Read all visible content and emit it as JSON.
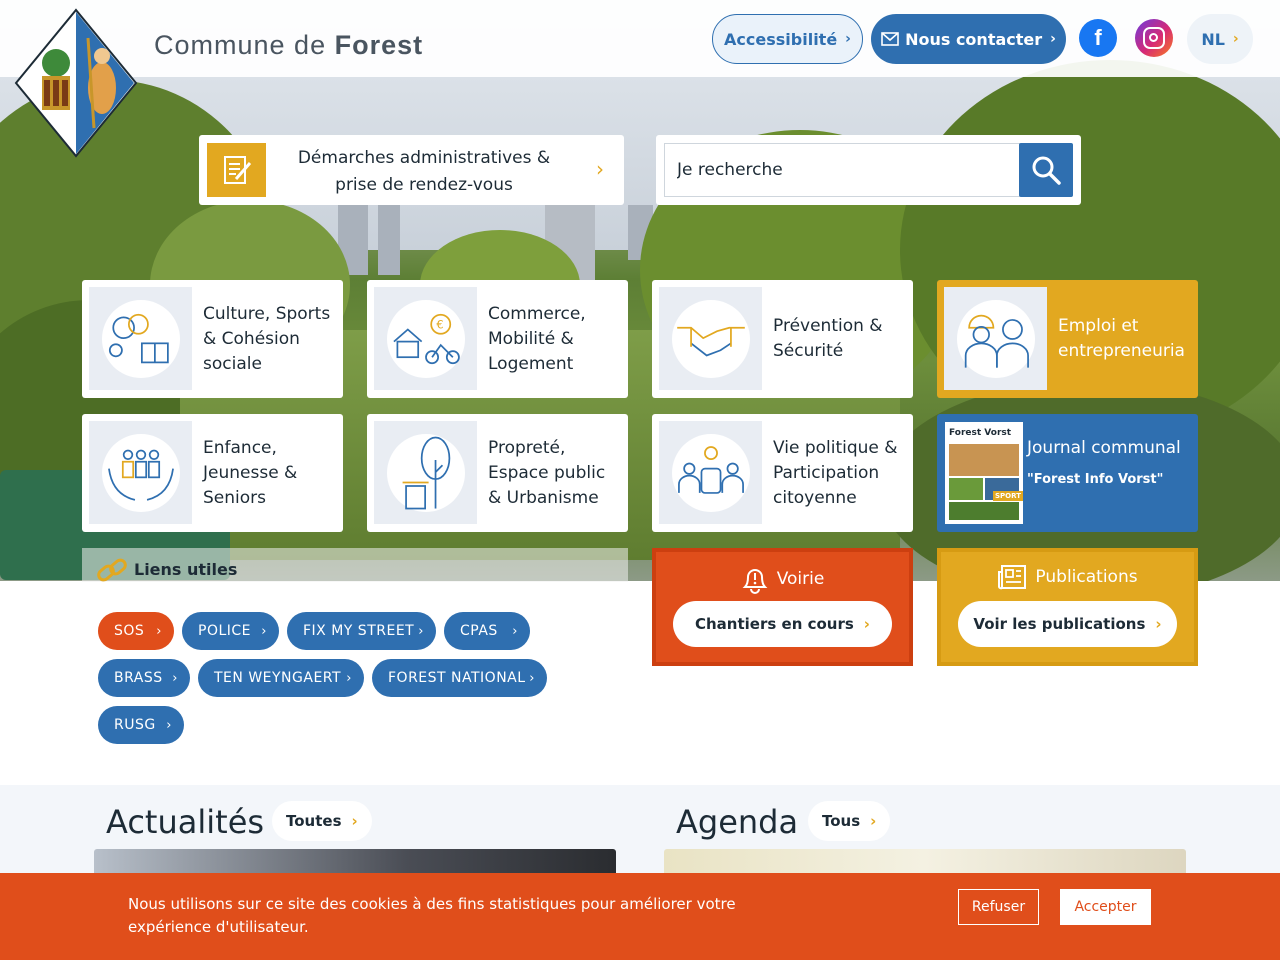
{
  "header": {
    "brand_prefix": "Commune de",
    "brand_name": "Forest",
    "accessibility_label": "Accessibilité",
    "contact_label": "Nous contacter",
    "facebook_icon": "facebook-icon",
    "instagram_icon": "instagram-icon",
    "language_label": "NL"
  },
  "quick": {
    "demarches_label": "Démarches administratives & prise de rendez-vous",
    "search_placeholder": "Je recherche"
  },
  "tiles": [
    {
      "label": "Culture, Sports & Cohésion sociale",
      "icon": "culture-icon"
    },
    {
      "label": "Commerce, Mobilité & Logement",
      "icon": "commerce-icon"
    },
    {
      "label": "Prévention & Sécurité",
      "icon": "handshake-icon"
    },
    {
      "label": "Emploi et entrepreneuria",
      "icon": "workers-icon"
    },
    {
      "label": "Enfance, Jeunesse & Seniors",
      "icon": "family-icon"
    },
    {
      "label": "Propreté, Espace public & Urbanisme",
      "icon": "tree-bin-icon"
    },
    {
      "label": "Vie politique & Participation citoyenne",
      "icon": "meeting-icon"
    },
    {
      "label": "Journal communal",
      "sub": "\"Forest Info Vorst\"",
      "cover_title": "Forest Vorst",
      "cover_badge": "SPORT",
      "icon": "journal-cover"
    }
  ],
  "liens": {
    "title": "Liens utiles",
    "tags": [
      "SOS",
      "POLICE",
      "FIX MY STREET",
      "CPAS",
      "BRASS",
      "TEN WEYNGAERT",
      "FOREST NATIONAL",
      "RUSG"
    ]
  },
  "voirie": {
    "title": "Voirie",
    "button": "Chantiers en cours",
    "color": "#e04e1b"
  },
  "publications": {
    "title": "Publications",
    "button": "Voir les publications",
    "color": "#e2a820"
  },
  "news": {
    "title": "Actualités",
    "button": "Toutes"
  },
  "agenda": {
    "title": "Agenda",
    "button": "Tous"
  },
  "cookie": {
    "text": "Nous utilisons sur ce site des cookies à des fins statistiques pour améliorer votre expérience d'utilisateur.",
    "refuse": "Refuser",
    "accept": "Accepter"
  },
  "colors": {
    "primary": "#2f6fb0",
    "accent": "#e2a820",
    "alert": "#e04e1b"
  }
}
